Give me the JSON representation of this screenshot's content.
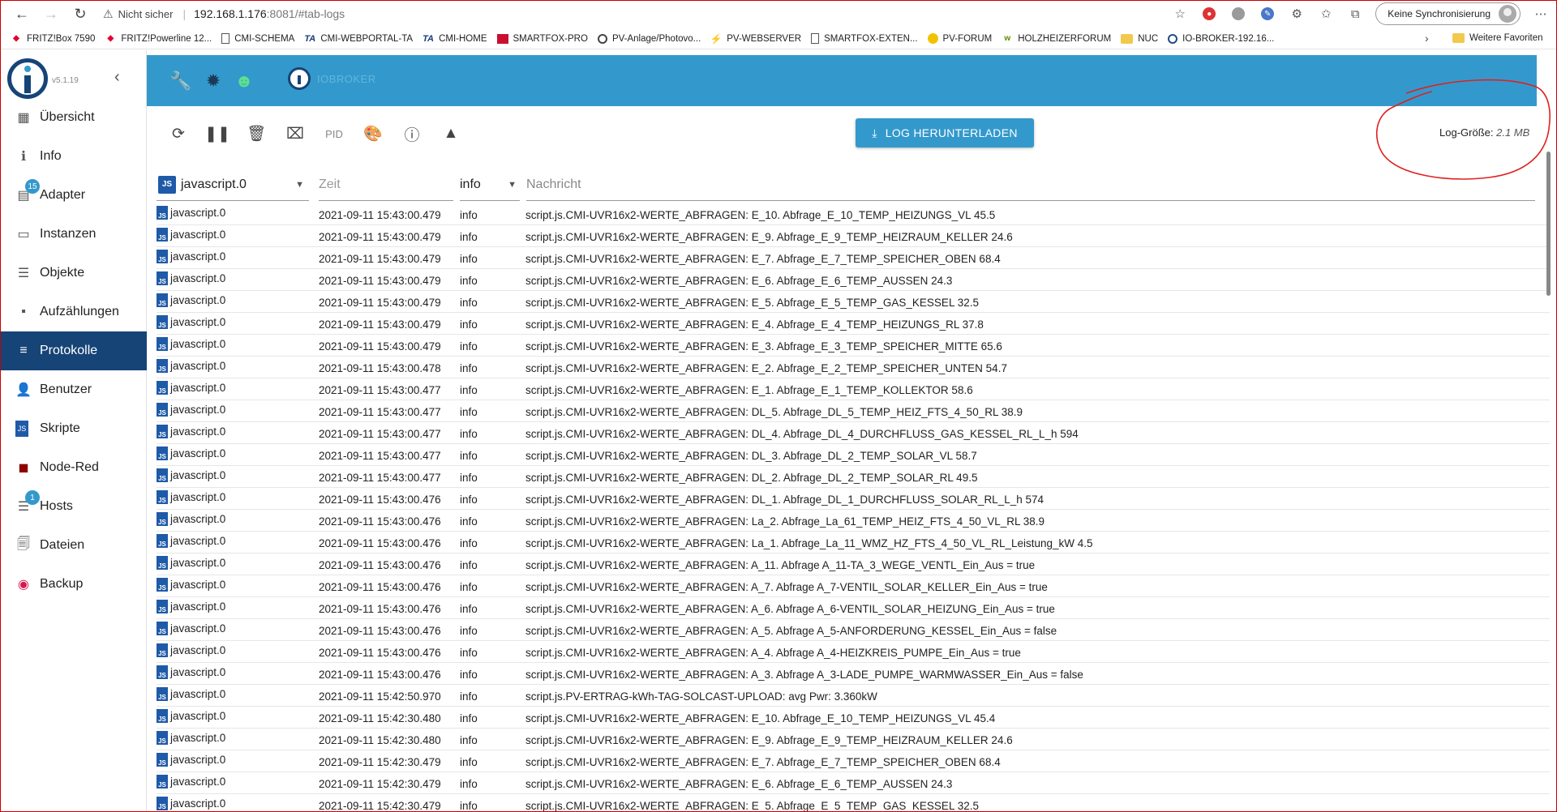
{
  "browser": {
    "security_label": "Nicht sicher",
    "url_host": "192.168.1.176",
    "url_rest": ":8081/#tab-logs",
    "sync_label": "Keine Synchronisierung"
  },
  "bookmarks": [
    {
      "label": "FRITZ!Box 7590",
      "icon": "fritz"
    },
    {
      "label": "FRITZ!Powerline 12...",
      "icon": "fritz"
    },
    {
      "label": "CMI-SCHEMA",
      "icon": "doc"
    },
    {
      "label": "CMI-WEBPORTAL-TA",
      "icon": "ta"
    },
    {
      "label": "CMI-HOME",
      "icon": "ta"
    },
    {
      "label": "SMARTFOX-PRO",
      "icon": "sf"
    },
    {
      "label": "PV-Anlage/Photovo...",
      "icon": "circ"
    },
    {
      "label": "PV-WEBSERVER",
      "icon": "pvw"
    },
    {
      "label": "SMARTFOX-EXTEN...",
      "icon": "doc"
    },
    {
      "label": "PV-FORUM",
      "icon": "forum"
    },
    {
      "label": "HOLZHEIZERFORUM",
      "icon": "holz"
    },
    {
      "label": "NUC",
      "icon": "folder"
    },
    {
      "label": "IO-BROKER-192.16...",
      "icon": "io"
    }
  ],
  "bookmarks_more": "Weitere Favoriten",
  "sidebar": {
    "version": "v5.1.19",
    "items": [
      {
        "label": "Übersicht",
        "icon": "grid-icon",
        "glyph": "▦"
      },
      {
        "label": "Info",
        "icon": "info-icon",
        "glyph": "ℹ"
      },
      {
        "label": "Adapter",
        "icon": "store-icon",
        "glyph": "▤",
        "badge": "15"
      },
      {
        "label": "Instanzen",
        "icon": "instances-icon",
        "glyph": "▭"
      },
      {
        "label": "Objekte",
        "icon": "list-icon",
        "glyph": "☰"
      },
      {
        "label": "Aufzählungen",
        "icon": "enum-icon",
        "glyph": "▪"
      },
      {
        "label": "Protokolle",
        "icon": "log-icon",
        "glyph": "≡",
        "active": true
      },
      {
        "label": "Benutzer",
        "icon": "user-icon",
        "glyph": "👤"
      },
      {
        "label": "Skripte",
        "icon": "script-icon",
        "glyph": "JS"
      },
      {
        "label": "Node-Red",
        "icon": "node-red-icon",
        "glyph": "◼"
      },
      {
        "label": "Hosts",
        "icon": "hosts-icon",
        "glyph": "☰",
        "badge": "1"
      },
      {
        "label": "Dateien",
        "icon": "files-icon",
        "glyph": "🗐"
      },
      {
        "label": "Backup",
        "icon": "backup-icon",
        "glyph": "◉"
      }
    ]
  },
  "topbar": {
    "title": "IOBROKER"
  },
  "log_toolbar": {
    "pid_label": "PID",
    "download_label": "LOG HERUNTERLADEN",
    "logsize_label": "Log-Größe:",
    "logsize_value": "2.1 MB"
  },
  "table": {
    "source_filter": "javascript.0",
    "time_placeholder": "Zeit",
    "level_filter": "info",
    "message_placeholder": "Nachricht",
    "rows": [
      {
        "source": "javascript.0",
        "time": "2021-09-11 15:43:00.479",
        "level": "info",
        "message": "script.js.CMI-UVR16x2-WERTE_ABFRAGEN: E_10. Abfrage_E_10_TEMP_HEIZUNGS_VL 45.5"
      },
      {
        "source": "javascript.0",
        "time": "2021-09-11 15:43:00.479",
        "level": "info",
        "message": "script.js.CMI-UVR16x2-WERTE_ABFRAGEN: E_9. Abfrage_E_9_TEMP_HEIZRAUM_KELLER 24.6"
      },
      {
        "source": "javascript.0",
        "time": "2021-09-11 15:43:00.479",
        "level": "info",
        "message": "script.js.CMI-UVR16x2-WERTE_ABFRAGEN: E_7. Abfrage_E_7_TEMP_SPEICHER_OBEN 68.4"
      },
      {
        "source": "javascript.0",
        "time": "2021-09-11 15:43:00.479",
        "level": "info",
        "message": "script.js.CMI-UVR16x2-WERTE_ABFRAGEN: E_6. Abfrage_E_6_TEMP_AUSSEN 24.3"
      },
      {
        "source": "javascript.0",
        "time": "2021-09-11 15:43:00.479",
        "level": "info",
        "message": "script.js.CMI-UVR16x2-WERTE_ABFRAGEN: E_5. Abfrage_E_5_TEMP_GAS_KESSEL 32.5"
      },
      {
        "source": "javascript.0",
        "time": "2021-09-11 15:43:00.479",
        "level": "info",
        "message": "script.js.CMI-UVR16x2-WERTE_ABFRAGEN: E_4. Abfrage_E_4_TEMP_HEIZUNGS_RL 37.8"
      },
      {
        "source": "javascript.0",
        "time": "2021-09-11 15:43:00.479",
        "level": "info",
        "message": "script.js.CMI-UVR16x2-WERTE_ABFRAGEN: E_3. Abfrage_E_3_TEMP_SPEICHER_MITTE 65.6"
      },
      {
        "source": "javascript.0",
        "time": "2021-09-11 15:43:00.478",
        "level": "info",
        "message": "script.js.CMI-UVR16x2-WERTE_ABFRAGEN: E_2. Abfrage_E_2_TEMP_SPEICHER_UNTEN 54.7"
      },
      {
        "source": "javascript.0",
        "time": "2021-09-11 15:43:00.477",
        "level": "info",
        "message": "script.js.CMI-UVR16x2-WERTE_ABFRAGEN: E_1. Abfrage_E_1_TEMP_KOLLEKTOR 58.6"
      },
      {
        "source": "javascript.0",
        "time": "2021-09-11 15:43:00.477",
        "level": "info",
        "message": "script.js.CMI-UVR16x2-WERTE_ABFRAGEN: DL_5. Abfrage_DL_5_TEMP_HEIZ_FTS_4_50_RL 38.9"
      },
      {
        "source": "javascript.0",
        "time": "2021-09-11 15:43:00.477",
        "level": "info",
        "message": "script.js.CMI-UVR16x2-WERTE_ABFRAGEN: DL_4. Abfrage_DL_4_DURCHFLUSS_GAS_KESSEL_RL_L_h 594"
      },
      {
        "source": "javascript.0",
        "time": "2021-09-11 15:43:00.477",
        "level": "info",
        "message": "script.js.CMI-UVR16x2-WERTE_ABFRAGEN: DL_3. Abfrage_DL_2_TEMP_SOLAR_VL 58.7"
      },
      {
        "source": "javascript.0",
        "time": "2021-09-11 15:43:00.477",
        "level": "info",
        "message": "script.js.CMI-UVR16x2-WERTE_ABFRAGEN: DL_2. Abfrage_DL_2_TEMP_SOLAR_RL 49.5"
      },
      {
        "source": "javascript.0",
        "time": "2021-09-11 15:43:00.476",
        "level": "info",
        "message": "script.js.CMI-UVR16x2-WERTE_ABFRAGEN: DL_1. Abfrage_DL_1_DURCHFLUSS_SOLAR_RL_L_h 574"
      },
      {
        "source": "javascript.0",
        "time": "2021-09-11 15:43:00.476",
        "level": "info",
        "message": "script.js.CMI-UVR16x2-WERTE_ABFRAGEN: La_2. Abfrage_La_61_TEMP_HEIZ_FTS_4_50_VL_RL 38.9"
      },
      {
        "source": "javascript.0",
        "time": "2021-09-11 15:43:00.476",
        "level": "info",
        "message": "script.js.CMI-UVR16x2-WERTE_ABFRAGEN: La_1. Abfrage_La_11_WMZ_HZ_FTS_4_50_VL_RL_Leistung_kW 4.5"
      },
      {
        "source": "javascript.0",
        "time": "2021-09-11 15:43:00.476",
        "level": "info",
        "message": "script.js.CMI-UVR16x2-WERTE_ABFRAGEN: A_11. Abfrage A_11-TA_3_WEGE_VENTL_Ein_Aus = true"
      },
      {
        "source": "javascript.0",
        "time": "2021-09-11 15:43:00.476",
        "level": "info",
        "message": "script.js.CMI-UVR16x2-WERTE_ABFRAGEN: A_7. Abfrage A_7-VENTIL_SOLAR_KELLER_Ein_Aus = true"
      },
      {
        "source": "javascript.0",
        "time": "2021-09-11 15:43:00.476",
        "level": "info",
        "message": "script.js.CMI-UVR16x2-WERTE_ABFRAGEN: A_6. Abfrage A_6-VENTIL_SOLAR_HEIZUNG_Ein_Aus = true"
      },
      {
        "source": "javascript.0",
        "time": "2021-09-11 15:43:00.476",
        "level": "info",
        "message": "script.js.CMI-UVR16x2-WERTE_ABFRAGEN: A_5. Abfrage A_5-ANFORDERUNG_KESSEL_Ein_Aus = false"
      },
      {
        "source": "javascript.0",
        "time": "2021-09-11 15:43:00.476",
        "level": "info",
        "message": "script.js.CMI-UVR16x2-WERTE_ABFRAGEN: A_4. Abfrage A_4-HEIZKREIS_PUMPE_Ein_Aus = true"
      },
      {
        "source": "javascript.0",
        "time": "2021-09-11 15:43:00.476",
        "level": "info",
        "message": "script.js.CMI-UVR16x2-WERTE_ABFRAGEN: A_3. Abfrage A_3-LADE_PUMPE_WARMWASSER_Ein_Aus = false"
      },
      {
        "source": "javascript.0",
        "time": "2021-09-11 15:42:50.970",
        "level": "info",
        "message": "script.js.PV-ERTRAG-kWh-TAG-SOLCAST-UPLOAD: avg Pwr: 3.360kW"
      },
      {
        "source": "javascript.0",
        "time": "2021-09-11 15:42:30.480",
        "level": "info",
        "message": "script.js.CMI-UVR16x2-WERTE_ABFRAGEN: E_10. Abfrage_E_10_TEMP_HEIZUNGS_VL 45.4"
      },
      {
        "source": "javascript.0",
        "time": "2021-09-11 15:42:30.480",
        "level": "info",
        "message": "script.js.CMI-UVR16x2-WERTE_ABFRAGEN: E_9. Abfrage_E_9_TEMP_HEIZRAUM_KELLER 24.6"
      },
      {
        "source": "javascript.0",
        "time": "2021-09-11 15:42:30.479",
        "level": "info",
        "message": "script.js.CMI-UVR16x2-WERTE_ABFRAGEN: E_7. Abfrage_E_7_TEMP_SPEICHER_OBEN 68.4"
      },
      {
        "source": "javascript.0",
        "time": "2021-09-11 15:42:30.479",
        "level": "info",
        "message": "script.js.CMI-UVR16x2-WERTE_ABFRAGEN: E_6. Abfrage_E_6_TEMP_AUSSEN 24.3"
      },
      {
        "source": "javascript.0",
        "time": "2021-09-11 15:42:30.479",
        "level": "info",
        "message": "script.js.CMI-UVR16x2-WERTE_ABFRAGEN: E_5. Abfrage_E_5_TEMP_GAS_KESSEL 32.5"
      }
    ]
  }
}
